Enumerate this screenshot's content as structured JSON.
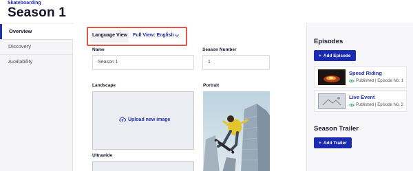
{
  "header": {
    "breadcrumb": "Skateboarding",
    "title": "Season 1"
  },
  "sidebar": {
    "items": [
      {
        "label": "Overview",
        "active": true
      },
      {
        "label": "Discovery",
        "active": false
      },
      {
        "label": "Availability",
        "active": false
      }
    ]
  },
  "language": {
    "label": "Language View",
    "selected": "Full View: English",
    "icon": "chevron-down-icon"
  },
  "form": {
    "name_label": "Name",
    "name_value": "Season 1",
    "season_number_label": "Season Number",
    "season_number_value": "1",
    "landscape_label": "Landscape",
    "upload_label": "Upload new image",
    "portrait_label": "Portrait",
    "ultrawide_label": "Ultrawide"
  },
  "episodes": {
    "title": "Episodes",
    "add_label": "Add Episode",
    "items": [
      {
        "title": "Speed Riding",
        "status": "Published | Episode No. 1"
      },
      {
        "title": "Live Event",
        "status": "Published | Episode No. 2"
      }
    ]
  },
  "trailer": {
    "title": "Season Trailer",
    "add_label": "Add Trailer"
  },
  "colors": {
    "accent": "#1f2fb0",
    "primary_button": "#1a2bb0",
    "highlight": "#e0554a",
    "published": "#2e9e5b"
  }
}
